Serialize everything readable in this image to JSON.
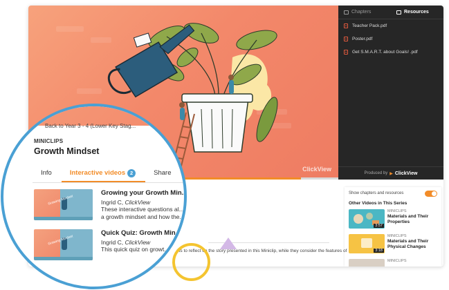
{
  "resources_panel": {
    "tabs": [
      {
        "label": "Chapters",
        "icon": "list-icon",
        "active": false
      },
      {
        "label": "Resources",
        "icon": "document-icon",
        "active": true
      }
    ],
    "files": [
      {
        "label": "Teacher Pack.pdf",
        "icon": "pdf-icon"
      },
      {
        "label": "Poster.pdf",
        "icon": "pdf-icon"
      },
      {
        "label": "Get S.M.A.R.T. about Goals! .pdf",
        "icon": "pdf-icon"
      }
    ],
    "produced_by_label": "Produced by",
    "produced_by_brand": "ClickView"
  },
  "video": {
    "watermark": "ClickView",
    "progress": 0.88
  },
  "page": {
    "back_link": "Back to Year 3 - 4 (Lower Key Stag...",
    "category": "MINICLIPS",
    "title": "Growth Mindset",
    "description_fragment": "nts to reflect on the story presented in this Miniclip, while they consider the features of"
  },
  "tabs": [
    {
      "label": "Info",
      "active": false
    },
    {
      "label": "Interactive videos",
      "active": true,
      "badge": "2"
    },
    {
      "label": "Share",
      "active": false
    }
  ],
  "interactive_videos": [
    {
      "title": "Growing your Growth Min...",
      "author": "Ingrid C,",
      "author_org": "ClickView",
      "description_line1": "These interactive questions al...",
      "description_line2": "a growth mindset and how the...",
      "thumb_text": "Growing Mindset"
    },
    {
      "title": "Quick Quiz: Growth Min...",
      "author": "Ingrid C,",
      "author_org": "ClickView",
      "description_line1": "This quick quiz on growt...",
      "description_line2": "",
      "thumb_text": "Growing Mindset"
    }
  ],
  "related_panel": {
    "toggle_label": "Show chapters and resources",
    "toggle_on": true,
    "heading": "Other Videos in This Series",
    "items": [
      {
        "category": "MINICLIPS",
        "title": "Materials and Their Properties",
        "duration": "3:57",
        "thumb_color": "#4bb7c4"
      },
      {
        "category": "MINICLIPS",
        "title": "Materials and Their Physical Changes",
        "duration": "3:18",
        "thumb_color": "#f6c344"
      },
      {
        "category": "MINICLIPS",
        "title": "",
        "duration": "",
        "thumb_color": "#d9cfc4"
      }
    ]
  },
  "colors": {
    "accent": "#f28c28",
    "magnifier_border": "#4aa0d4",
    "badge": "#4aa0d4",
    "highlight_ring": "#f4c430"
  }
}
